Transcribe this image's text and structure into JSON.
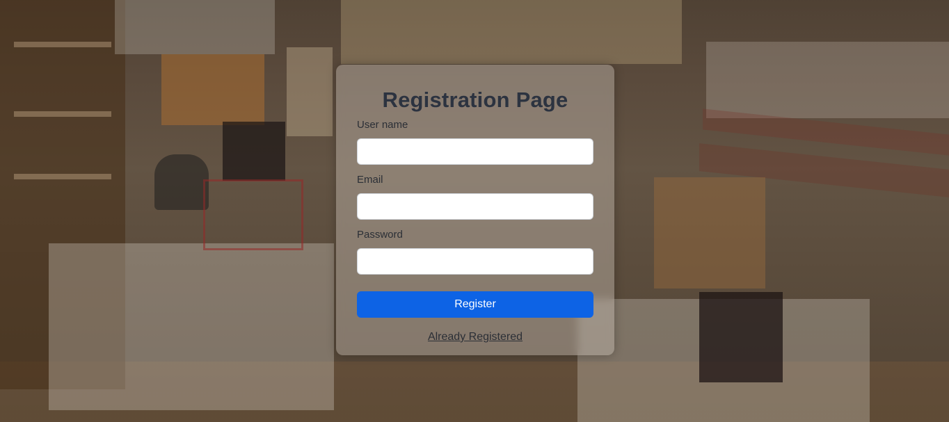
{
  "registration": {
    "title": "Registration Page",
    "username_label": "User name",
    "username_value": "",
    "email_label": "Email",
    "email_value": "",
    "password_label": "Password",
    "password_value": "",
    "register_button": "Register",
    "login_link": "Already Registered"
  },
  "colors": {
    "accent": "#0d63e5",
    "title_text": "#2c3340",
    "label_text": "#2b2f36",
    "card_background": "rgba(200,190,180,0.42)"
  },
  "background": {
    "kind": "photo",
    "subject": "stationery-store-interior"
  }
}
